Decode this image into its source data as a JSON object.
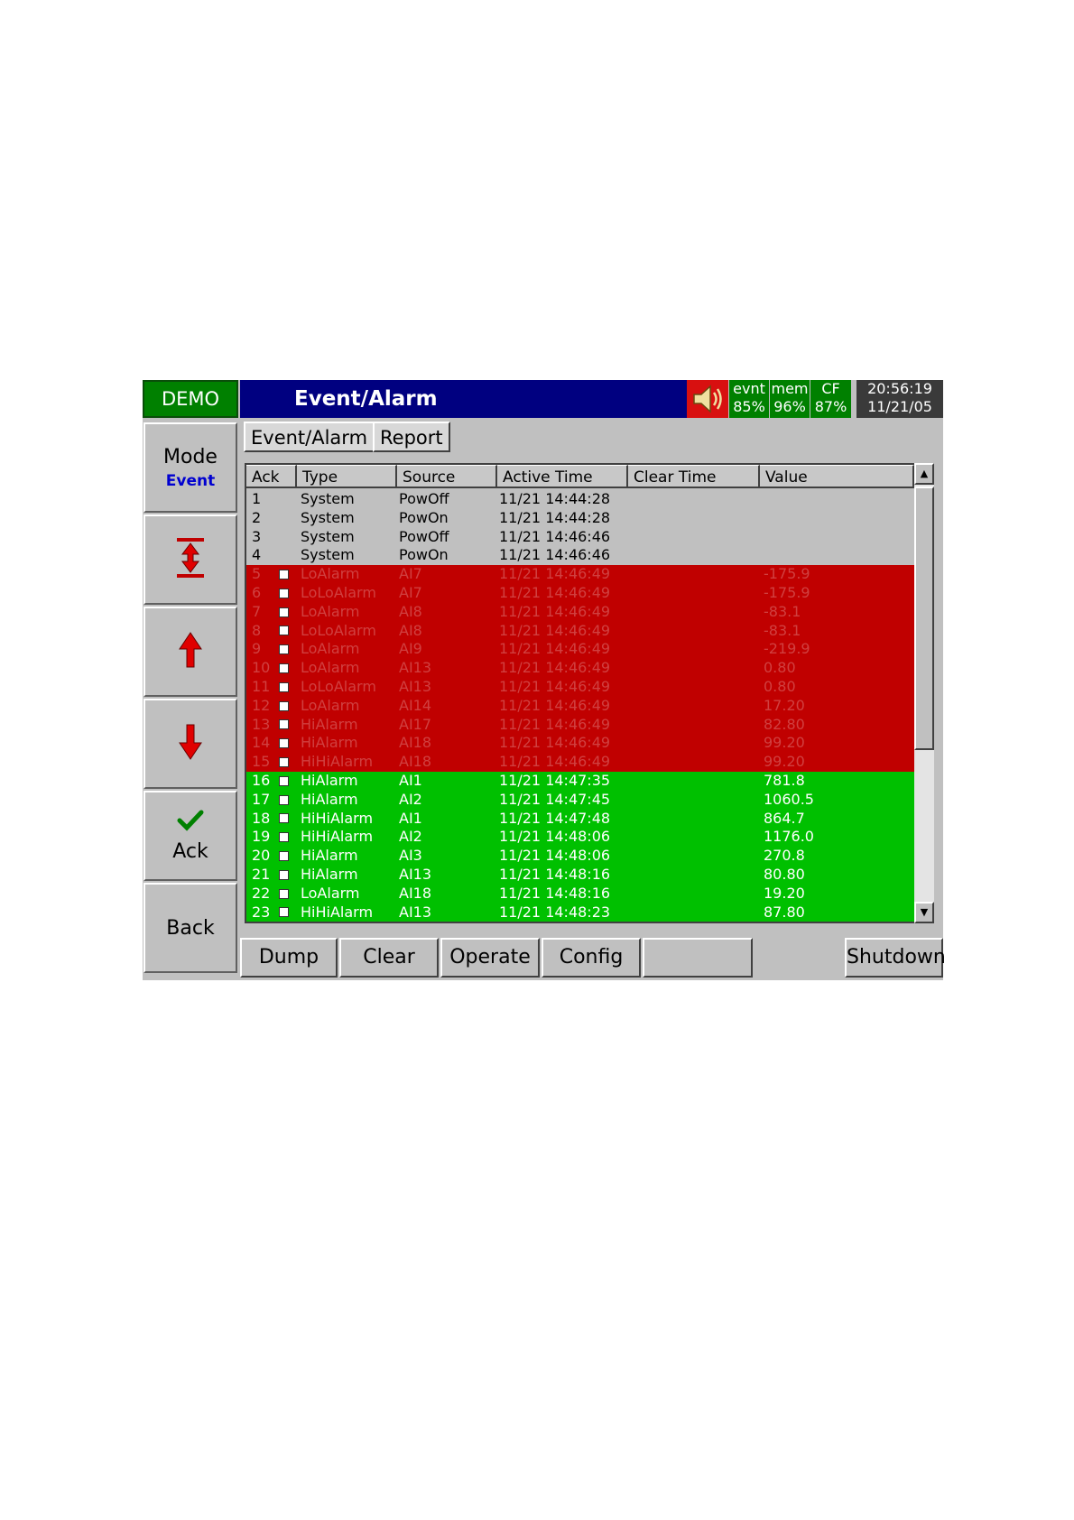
{
  "header": {
    "demo_label": "DEMO",
    "title": "Event/Alarm",
    "status": [
      {
        "label": "evnt",
        "value": "85%"
      },
      {
        "label": "mem",
        "value": "96%"
      },
      {
        "label": "CF",
        "value": "87%"
      }
    ],
    "clock": {
      "time": "20:56:19",
      "date": "11/21/05"
    }
  },
  "sidebar": {
    "mode_label": "Mode",
    "mode_value": "Event",
    "ack_label": "Ack",
    "back_label": "Back"
  },
  "tabs": [
    "Event/Alarm",
    "Report"
  ],
  "table": {
    "columns": [
      "Ack",
      "Type",
      "Source",
      "Active Time",
      "Clear Time",
      "Value"
    ],
    "rows": [
      {
        "no": "1",
        "type": "System",
        "source": "PowOff",
        "active": "11/21 14:44:28",
        "clear": "",
        "value": "",
        "status": "sys"
      },
      {
        "no": "2",
        "type": "System",
        "source": "PowOn",
        "active": "11/21 14:44:28",
        "clear": "",
        "value": "",
        "status": "sys"
      },
      {
        "no": "3",
        "type": "System",
        "source": "PowOff",
        "active": "11/21 14:46:46",
        "clear": "",
        "value": "",
        "status": "sys"
      },
      {
        "no": "4",
        "type": "System",
        "source": "PowOn",
        "active": "11/21 14:46:46",
        "clear": "",
        "value": "",
        "status": "sys"
      },
      {
        "no": "5",
        "type": "LoAlarm",
        "source": "AI7",
        "active": "11/21 14:46:49",
        "clear": "",
        "value": "-175.9",
        "status": "red"
      },
      {
        "no": "6",
        "type": "LoLoAlarm",
        "source": "AI7",
        "active": "11/21 14:46:49",
        "clear": "",
        "value": "-175.9",
        "status": "red"
      },
      {
        "no": "7",
        "type": "LoAlarm",
        "source": "AI8",
        "active": "11/21 14:46:49",
        "clear": "",
        "value": "-83.1",
        "status": "red"
      },
      {
        "no": "8",
        "type": "LoLoAlarm",
        "source": "AI8",
        "active": "11/21 14:46:49",
        "clear": "",
        "value": "-83.1",
        "status": "red"
      },
      {
        "no": "9",
        "type": "LoAlarm",
        "source": "AI9",
        "active": "11/21 14:46:49",
        "clear": "",
        "value": "-219.9",
        "status": "red"
      },
      {
        "no": "10",
        "type": "LoAlarm",
        "source": "AI13",
        "active": "11/21 14:46:49",
        "clear": "",
        "value": "0.80",
        "status": "red"
      },
      {
        "no": "11",
        "type": "LoLoAlarm",
        "source": "AI13",
        "active": "11/21 14:46:49",
        "clear": "",
        "value": "0.80",
        "status": "red"
      },
      {
        "no": "12",
        "type": "LoAlarm",
        "source": "AI14",
        "active": "11/21 14:46:49",
        "clear": "",
        "value": "17.20",
        "status": "red"
      },
      {
        "no": "13",
        "type": "HiAlarm",
        "source": "AI17",
        "active": "11/21 14:46:49",
        "clear": "",
        "value": "82.80",
        "status": "red"
      },
      {
        "no": "14",
        "type": "HiAlarm",
        "source": "AI18",
        "active": "11/21 14:46:49",
        "clear": "",
        "value": "99.20",
        "status": "red"
      },
      {
        "no": "15",
        "type": "HiHiAlarm",
        "source": "AI18",
        "active": "11/21 14:46:49",
        "clear": "",
        "value": "99.20",
        "status": "red"
      },
      {
        "no": "16",
        "type": "HiAlarm",
        "source": "AI1",
        "active": "11/21 14:47:35",
        "clear": "",
        "value": "781.8",
        "status": "green"
      },
      {
        "no": "17",
        "type": "HiAlarm",
        "source": "AI2",
        "active": "11/21 14:47:45",
        "clear": "",
        "value": "1060.5",
        "status": "green"
      },
      {
        "no": "18",
        "type": "HiHiAlarm",
        "source": "AI1",
        "active": "11/21 14:47:48",
        "clear": "",
        "value": "864.7",
        "status": "green"
      },
      {
        "no": "19",
        "type": "HiHiAlarm",
        "source": "AI2",
        "active": "11/21 14:48:06",
        "clear": "",
        "value": "1176.0",
        "status": "green"
      },
      {
        "no": "20",
        "type": "HiAlarm",
        "source": "AI3",
        "active": "11/21 14:48:06",
        "clear": "",
        "value": "270.8",
        "status": "green"
      },
      {
        "no": "21",
        "type": "HiAlarm",
        "source": "AI13",
        "active": "11/21 14:48:16",
        "clear": "",
        "value": "80.80",
        "status": "green"
      },
      {
        "no": "22",
        "type": "LoAlarm",
        "source": "AI18",
        "active": "11/21 14:48:16",
        "clear": "",
        "value": "19.20",
        "status": "green"
      },
      {
        "no": "23",
        "type": "HiHiAlarm",
        "source": "AI13",
        "active": "11/21 14:48:23",
        "clear": "",
        "value": "87.80",
        "status": "green"
      }
    ]
  },
  "toolbar": {
    "dump_label": "Dump",
    "clear_label": "Clear",
    "operate_label": "Operate",
    "config_label": "Config",
    "blank_label": "",
    "shutdown_label": "Shutdown"
  },
  "icons": {
    "speaker": "speaker-icon",
    "page_jump": "expand-vertical-icon",
    "up": "arrow-up-icon",
    "down": "arrow-down-icon",
    "ack": "checkmark-icon",
    "scroll_up": "triangle-up-icon",
    "scroll_down": "triangle-down-icon"
  },
  "colors": {
    "header_green": "#008000",
    "title_blue": "#000080",
    "alarm_red": "#c00000",
    "alarm_green": "#00c000",
    "arrow_red": "#e00000"
  }
}
